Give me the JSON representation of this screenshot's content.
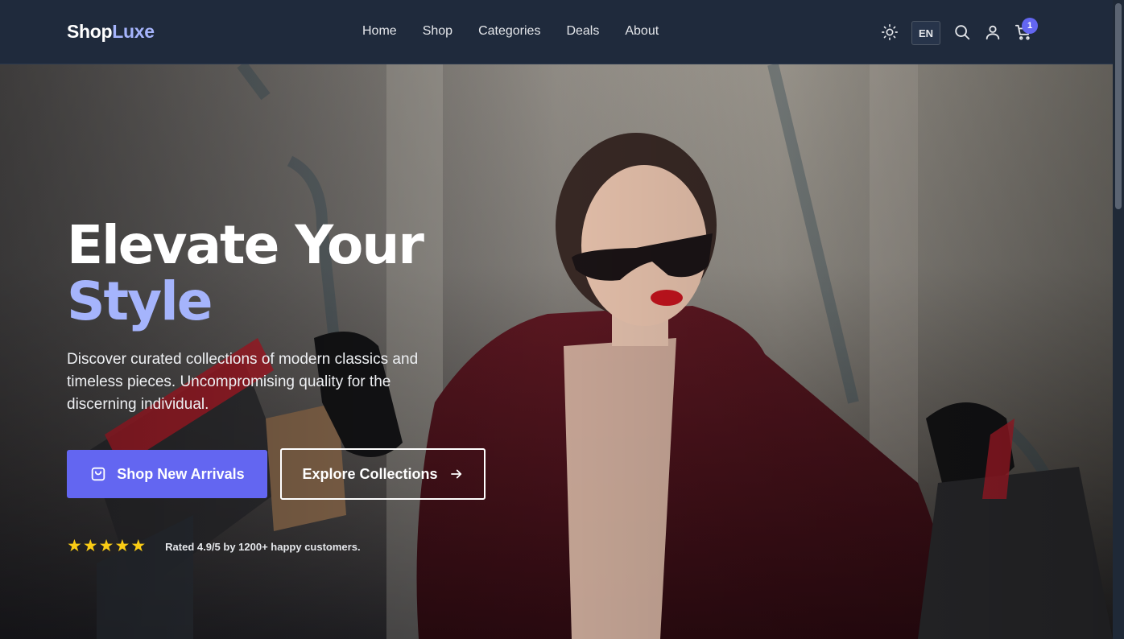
{
  "brand": {
    "name_main": "Shop",
    "name_accent": "Luxe"
  },
  "nav": {
    "links": [
      "Home",
      "Shop",
      "Categories",
      "Deals",
      "About"
    ]
  },
  "actions": {
    "theme_icon": "sun-icon",
    "language": "EN",
    "search_icon": "search-icon",
    "account_icon": "user-icon",
    "cart_icon": "cart-icon",
    "cart_count": "1"
  },
  "hero": {
    "title_line1": "Elevate Your",
    "title_line2": "Style",
    "subtitle": "Discover curated collections of modern classics and timeless pieces. Uncompromising quality for the discerning individual.",
    "primary_cta": "Shop New Arrivals",
    "secondary_cta": "Explore Collections",
    "rating_stars": 5,
    "rating_text": "Rated 4.9/5 by 1200+ happy customers."
  },
  "colors": {
    "accent": "#6366f1",
    "accent_light": "#a5b4fc",
    "navbar_bg": "#1f2a3c",
    "star": "#facc15"
  }
}
